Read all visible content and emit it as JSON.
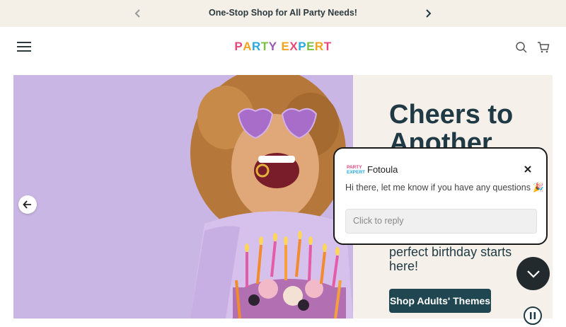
{
  "announcement": {
    "text": "One-Stop Shop for All Party Needs!",
    "prev_icon": "chevron-left-icon",
    "next_icon": "chevron-right-icon"
  },
  "header": {
    "logo": [
      "P",
      "A",
      "R",
      "T",
      "Y",
      " ",
      "E",
      "X",
      "P",
      "E",
      "R",
      "T"
    ],
    "logo_colors": [
      "#e9477b",
      "#f2a31c",
      "#27a8e0",
      "#7bc043",
      "#9b59b6",
      "#ffffff",
      "#f2a31c",
      "#e9477b",
      "#27a8e0",
      "#7bc043",
      "#f2a31c",
      "#e9477b"
    ],
    "menu_icon": "hamburger-icon",
    "search_icon": "search-icon",
    "cart_icon": "cart-icon"
  },
  "hero": {
    "headline": "Cheers to Another",
    "subtext": "perfect birthday starts here!",
    "cta_label": "Shop Adults' Themes",
    "prev_icon": "arrow-left-icon"
  },
  "chat": {
    "logo_lines": [
      "PARTY",
      "EXPERT"
    ],
    "agent_name": "Fotoula",
    "message": "Hi there, let me know if you have any questions 🎉",
    "reply_placeholder": "Click to reply",
    "close_icon": "close-icon"
  },
  "widgets": {
    "chat_toggle_icon": "chevron-down-icon",
    "pause_icon": "pause-icon"
  },
  "colors": {
    "brand_dark": "#1f3a44",
    "announcement_bg": "#f4efe7",
    "hero_bg": "#f5f0e9",
    "photo_bg": "#c9b6e4"
  }
}
